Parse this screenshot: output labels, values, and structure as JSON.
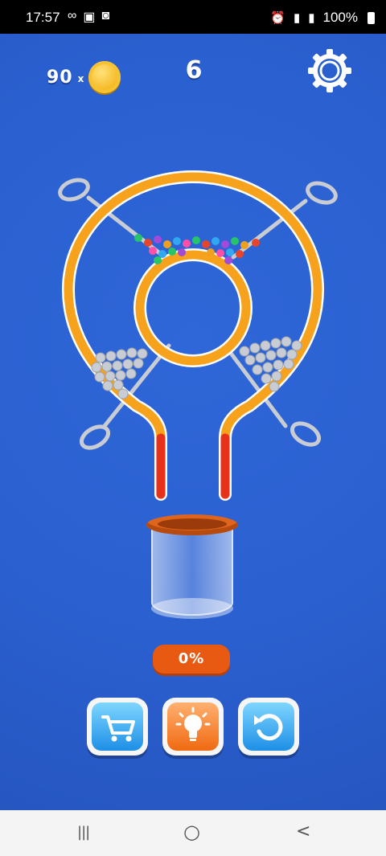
{
  "status_bar": {
    "time": "17:57",
    "left_icons": [
      "infinity-icon",
      "image-icon",
      "wifi-box-icon"
    ],
    "right_icons": [
      "alarm-icon",
      "signal-icon",
      "signal-icon"
    ],
    "battery": "100%"
  },
  "hud": {
    "coins": "90",
    "coin_multiplier": "x",
    "level": "6",
    "settings_icon": "gear-icon"
  },
  "progress": {
    "label": "0%"
  },
  "buttons": {
    "shop_icon": "cart-icon",
    "hint_icon": "lightbulb-icon",
    "restart_icon": "restart-icon"
  },
  "nav_bar": {
    "recents": "|||",
    "home": "○",
    "back": "<"
  },
  "colors": {
    "background": "#2a5fcf",
    "pipe_orange": "#f6a21d",
    "pipe_red": "#e8311b",
    "progress_pill": "#e85a12",
    "coin": "#f4b51b"
  }
}
